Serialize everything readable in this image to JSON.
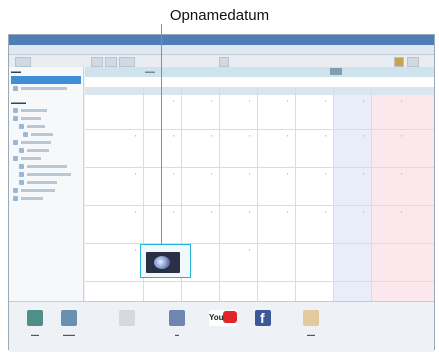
{
  "callout": {
    "label": "Opnamedatum"
  },
  "colors": {
    "accent": "#23b5d9",
    "titlebar": "#4d7fb6",
    "selection": "#3f8ed8",
    "saturday": "#e8eef9",
    "sunday": "#fbe8ec"
  },
  "icons": [
    "thumbnail-image",
    "youtube-logo-icon",
    "facebook-logo-icon"
  ],
  "dock": {
    "youtube_text": "You"
  }
}
